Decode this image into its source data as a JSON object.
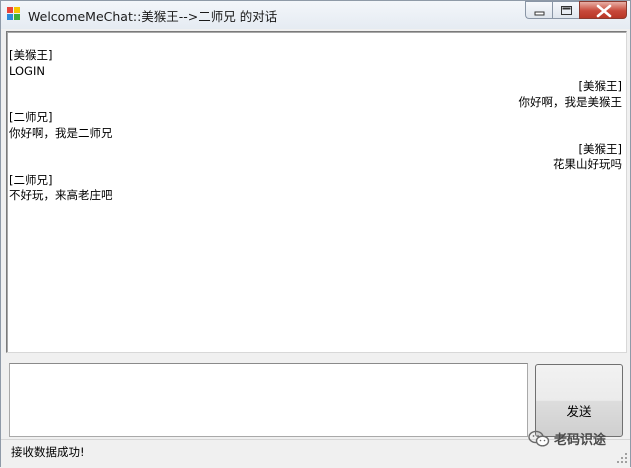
{
  "window": {
    "title": "WelcomeMeChat::美猴王-->二师兄 的对话"
  },
  "chat": {
    "messages": [
      {
        "sender": "[美猴王]",
        "text": "LOGIN",
        "align": "left"
      },
      {
        "sender": "[美猴王]",
        "text": "你好啊，我是美猴王",
        "align": "right"
      },
      {
        "sender": "[二师兄]",
        "text": "你好啊，我是二师兄",
        "align": "left"
      },
      {
        "sender": "[美猴王]",
        "text": "花果山好玩吗",
        "align": "right"
      },
      {
        "sender": "[二师兄]",
        "text": "不好玩，来高老庄吧",
        "align": "left"
      }
    ]
  },
  "composer": {
    "value": "",
    "send_label": "发送"
  },
  "status": {
    "text": "接收数据成功!"
  },
  "watermark": {
    "text": "老码识途"
  },
  "colors": {
    "close_button": "#c8493a",
    "window_border": "#8f9aa8"
  },
  "icons": {
    "app": "app-icon",
    "minimize": "minimize-icon",
    "maximize": "maximize-icon",
    "close": "close-icon",
    "watermark": "wechat-icon"
  }
}
